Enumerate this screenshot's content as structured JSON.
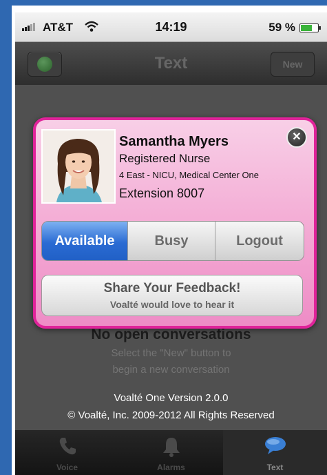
{
  "status_bar": {
    "carrier": "AT&T",
    "time": "14:19",
    "battery": "59 %"
  },
  "nav": {
    "title": "Text",
    "new_label": "New"
  },
  "profile": {
    "name": "Samantha Myers",
    "role": "Registered Nurse",
    "location": "4 East - NICU, Medical Center One",
    "extension": "Extension 8007"
  },
  "status_options": [
    {
      "label": "Available",
      "selected": true
    },
    {
      "label": "Busy",
      "selected": false
    },
    {
      "label": "Logout",
      "selected": false
    }
  ],
  "feedback": {
    "title": "Share Your Feedback!",
    "subtitle": "Voalté would love to hear it"
  },
  "empty_state": {
    "title": "No open conversations",
    "line1": "Select the \"New\" button to",
    "line2": "begin a new conversation"
  },
  "footer": {
    "version": "Voalté One  Version 2.0.0",
    "copyright": "© Voalté, Inc. 2009-2012 All Rights Reserved"
  },
  "tabs": [
    {
      "label": "Voice",
      "icon": "phone-icon",
      "active": false
    },
    {
      "label": "Alarms",
      "icon": "bell-icon",
      "active": false
    },
    {
      "label": "Text",
      "icon": "speech-bubble-icon",
      "active": true
    }
  ],
  "colors": {
    "accent_pink": "#e0239a",
    "available_blue": "#2a6bd3",
    "presence_green": "#3ab43a"
  }
}
